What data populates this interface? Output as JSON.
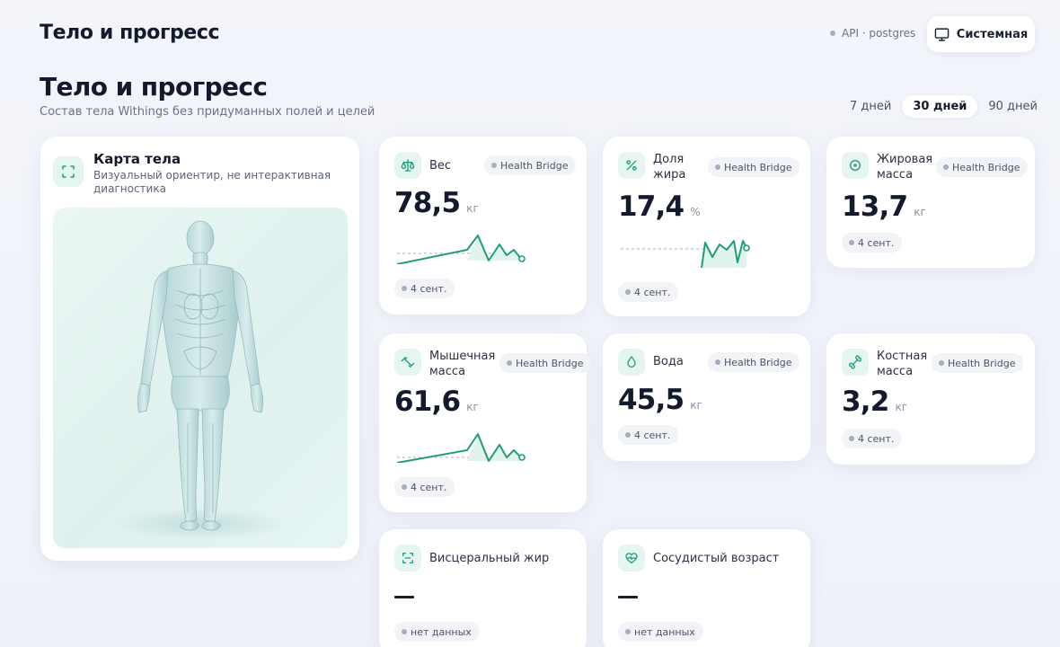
{
  "header": {
    "app_title": "Тело и прогресс",
    "api_status": "API · postgres",
    "theme_button": "Системная"
  },
  "page": {
    "title": "Тело и прогресс",
    "subtitle": "Состав тела Withings без придуманных полей и целей"
  },
  "periods": {
    "items": [
      "7 дней",
      "30 дней",
      "90 дней"
    ],
    "selected": "30 дней"
  },
  "body_map": {
    "title": "Карта тела",
    "subtitle": "Визуальный ориентир, не интерактивная диагностика"
  },
  "colors": {
    "accent": "#1f9e76",
    "accent_soft": "#e5f5f0",
    "badge_bg": "#f1f3f7"
  },
  "metrics": [
    {
      "label": "Вес",
      "icon": "scale-icon",
      "source": "Health Bridge",
      "value": "78,5",
      "unit": "кг",
      "date": "4 сент."
    },
    {
      "label": "Доля жира",
      "icon": "percent-icon",
      "source": "Health Bridge",
      "value": "17,4",
      "unit": "%",
      "date": "4 сент."
    },
    {
      "label": "Жировая масса",
      "icon": "target-icon",
      "source": "Health Bridge",
      "value": "13,7",
      "unit": "кг",
      "date": "4 сент."
    },
    {
      "label": "Мышечная масса",
      "icon": "dumbbell-icon",
      "source": "Health Bridge",
      "value": "61,6",
      "unit": "кг",
      "date": "4 сент."
    },
    {
      "label": "Вода",
      "icon": "drop-icon",
      "source": "Health Bridge",
      "value": "45,5",
      "unit": "кг",
      "date": "4 сент."
    },
    {
      "label": "Костная масса",
      "icon": "bone-icon",
      "source": "Health Bridge",
      "value": "3,2",
      "unit": "кг",
      "date": "4 сент."
    },
    {
      "label": "Висцеральный жир",
      "icon": "scan-icon",
      "value": "—",
      "date": "нет данных"
    },
    {
      "label": "Сосудистый возраст",
      "icon": "heart-pulse-icon",
      "value": "—",
      "date": "нет данных"
    }
  ]
}
